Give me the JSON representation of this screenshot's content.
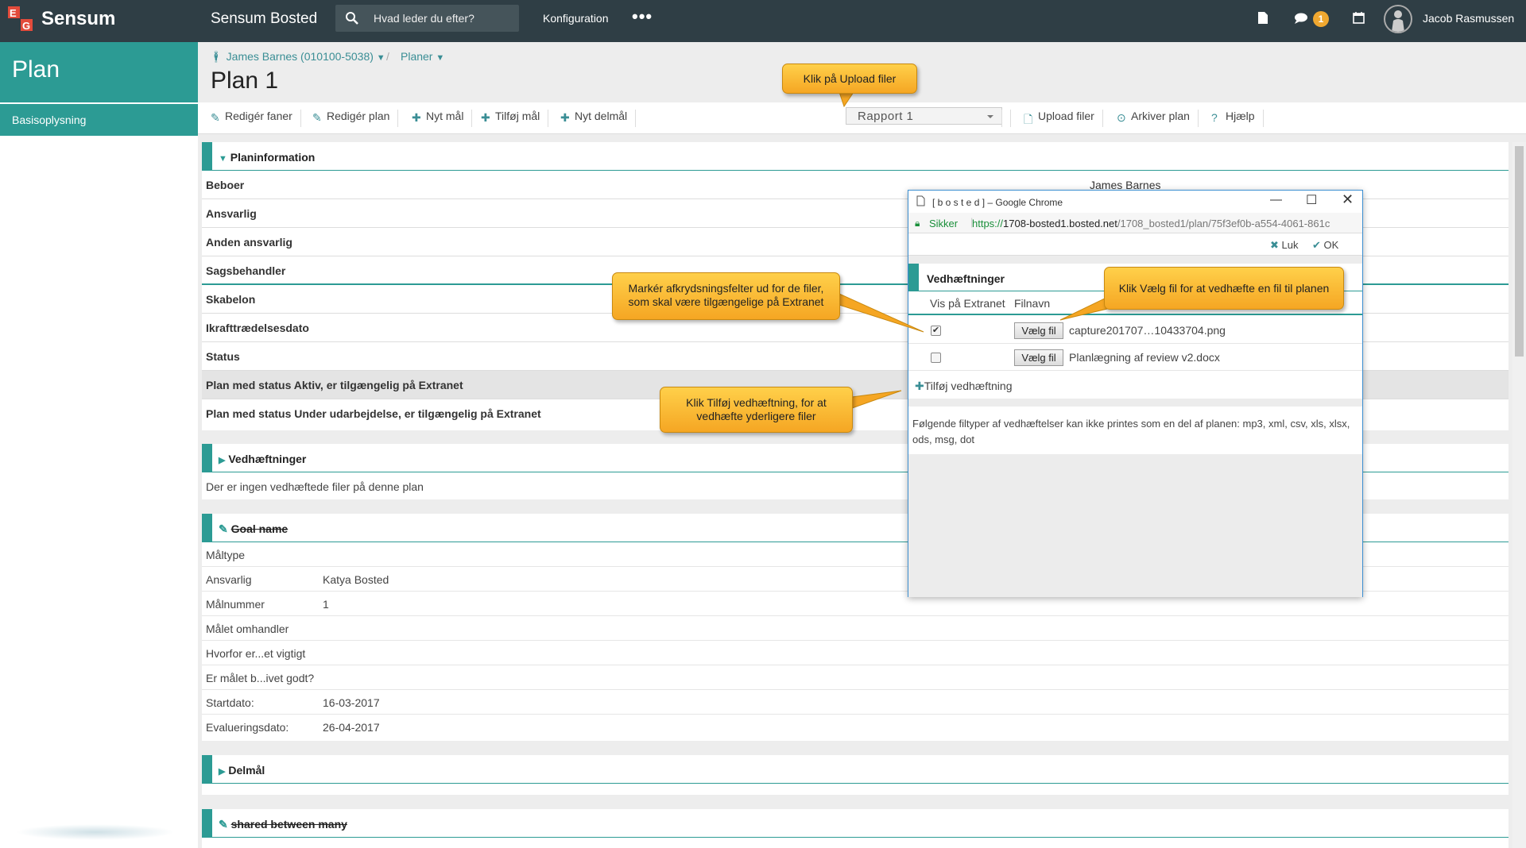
{
  "topbar": {
    "logo_text": "Sensum",
    "app_title": "Sensum Bosted",
    "search_placeholder": "Hvad leder du efter?",
    "config_label": "Konfiguration",
    "more_label": "•••",
    "message_count": "1",
    "user_name": "Jacob Rasmussen"
  },
  "sidebar": {
    "heading": "Plan",
    "items": [
      {
        "label": "Basisoplysning"
      }
    ]
  },
  "header": {
    "breadcrumb_person": "James Barnes (010100-5038)",
    "breadcrumb_separator": "/",
    "breadcrumb_plans": "Planer",
    "title": "Plan 1"
  },
  "toolbar": {
    "edit_tabs": "Redigér faner",
    "edit_plan": "Redigér plan",
    "new_goal": "Nyt mål",
    "add_goal": "Tilføj mål",
    "new_subgoal": "Nyt delmål",
    "report_select": "Rapport 1",
    "upload_files": "Upload filer",
    "archive_plan": "Arkiver plan",
    "help": "Hjælp"
  },
  "plan_info": {
    "heading": "Planinformation",
    "rows": [
      {
        "label": "Beboer",
        "value": "James Barnes"
      },
      {
        "label": "Ansvarlig"
      },
      {
        "label": "Anden ansvarlig"
      },
      {
        "label": "Sagsbehandler"
      },
      {
        "label": "Skabelon"
      },
      {
        "label": "Ikrafttrædelsesdato"
      },
      {
        "label": "Status"
      },
      {
        "label": "Plan med status Aktiv, er tilgængelig på Extranet"
      },
      {
        "label": "Plan med status Under udarbejdelse, er tilgængelig på Extranet"
      }
    ]
  },
  "attachments_section": {
    "heading": "Vedhæftninger",
    "empty_text": "Der er ingen vedhæftede filer på denne plan"
  },
  "goal": {
    "heading": "Goal name",
    "rows": [
      {
        "label": "Måltype",
        "value": ""
      },
      {
        "label": "Ansvarlig",
        "value": "Katya Bosted"
      },
      {
        "label": "Målnummer",
        "value": "1"
      },
      {
        "label": "Målet omhandler",
        "value": ""
      },
      {
        "label": "Hvorfor er...et vigtigt",
        "value": ""
      },
      {
        "label": "Er målet b...ivet godt?",
        "value": ""
      },
      {
        "label": "Startdato:",
        "value": "16-03-2017"
      },
      {
        "label": "Evalueringsdato:",
        "value": "26-04-2017"
      }
    ]
  },
  "subgoals": {
    "heading": "Delmål"
  },
  "shared": {
    "heading": "shared between many"
  },
  "dialog": {
    "window_title": "[ b o s t e d ] – Google Chrome",
    "secure_label": "Sikker",
    "url_scheme": "https://",
    "url_host": "1708-bosted1.bosted.net",
    "url_path": "/1708_bosted1/plan/75f3ef0b-a554-4061-861c",
    "close_label": "Luk",
    "ok_label": "OK",
    "section_heading": "Vedhæftninger",
    "col_extranet": "Vis på Extranet",
    "col_filename": "Filnavn",
    "files": [
      {
        "checked": "✔",
        "button": "Vælg fil",
        "name": "capture201707…10433704.png"
      },
      {
        "checked": "",
        "button": "Vælg fil",
        "name": "Planlægning af review v2.docx"
      }
    ],
    "add_attachment": "Tilføj vedhæftning",
    "note": "Følgende filtyper af vedhæftelser kan ikke printes som en del af planen: mp3, xml, csv, xls, xlsx, ods, msg, dot"
  },
  "callouts": {
    "upload": "Klik på Upload filer",
    "choose_file": "Klik Vælg fil for at vedhæfte en fil til planen",
    "checkboxes": "Markér afkrydsningsfelter ud for de filer, som skal være tilgængelige på Extranet",
    "add_attachment": "Klik Tilføj vedhæftning, for at vedhæfte yderligere filer"
  },
  "colors": {
    "topbar": "#2f3e45",
    "accent": "#2c9b94",
    "callout": "#f5a623",
    "badge": "#f0a830"
  }
}
